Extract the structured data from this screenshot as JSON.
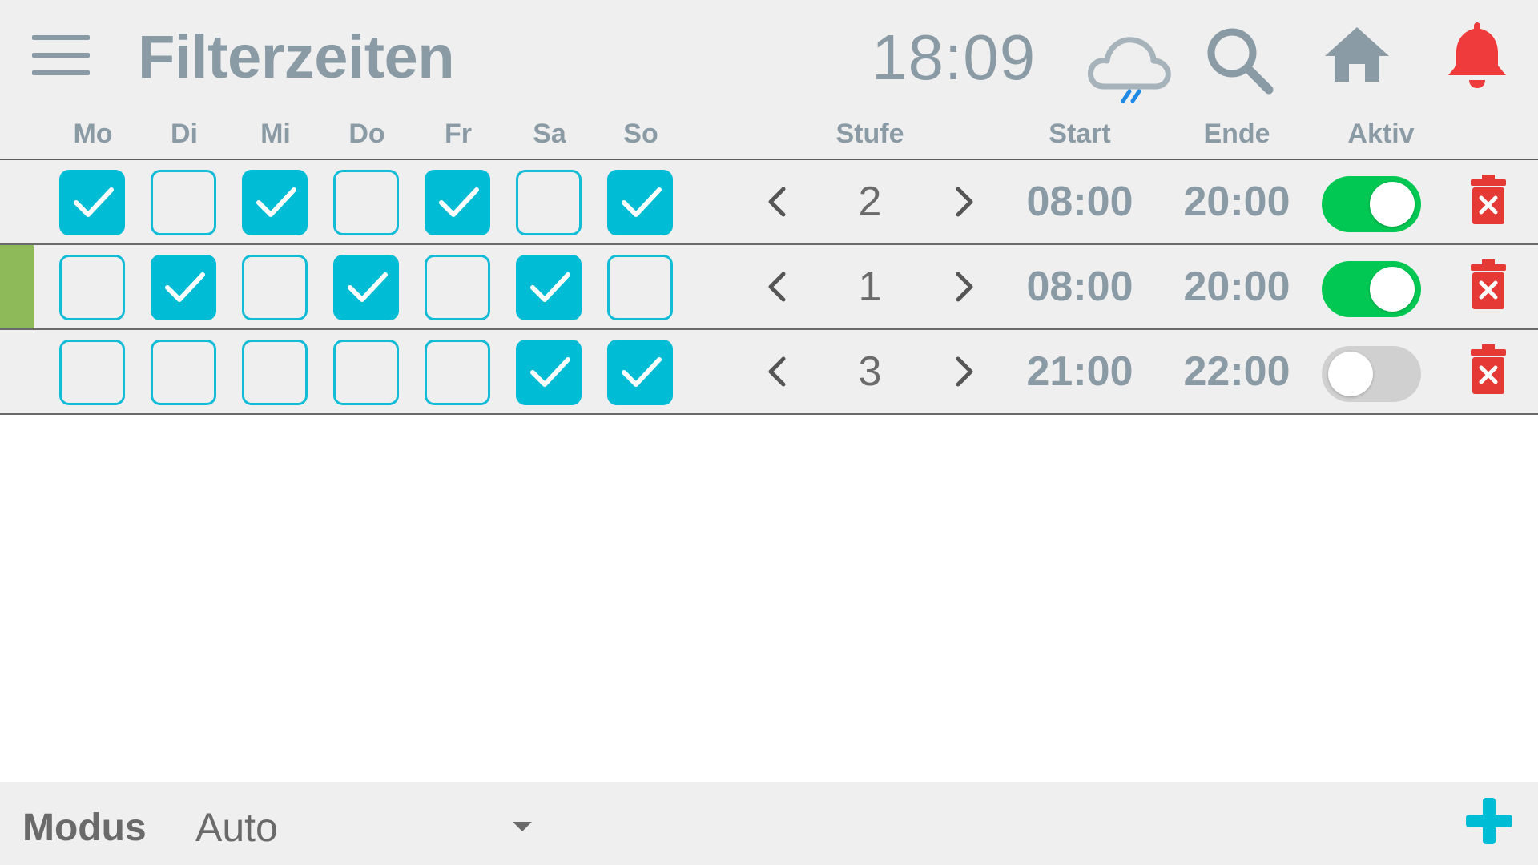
{
  "header": {
    "title": "Filterzeiten",
    "time": "18:09",
    "icons": [
      "menu-icon",
      "rain-cloud-icon",
      "search-icon",
      "home-icon",
      "bell-icon"
    ],
    "colors": {
      "title": "#8b9ba5",
      "bell": "#ef3b3b",
      "rain": "#1e88e5"
    }
  },
  "columns": {
    "days": [
      "Mo",
      "Di",
      "Mi",
      "Do",
      "Fr",
      "Sa",
      "So"
    ],
    "stufe": "Stufe",
    "start": "Start",
    "ende": "Ende",
    "aktiv": "Aktiv"
  },
  "rows": [
    {
      "days": [
        true,
        false,
        true,
        false,
        true,
        false,
        true
      ],
      "stufe": "2",
      "start": "08:00",
      "ende": "20:00",
      "aktiv": true,
      "selected": false
    },
    {
      "days": [
        false,
        true,
        false,
        true,
        false,
        true,
        false
      ],
      "stufe": "1",
      "start": "08:00",
      "ende": "20:00",
      "aktiv": true,
      "selected": true
    },
    {
      "days": [
        false,
        false,
        false,
        false,
        false,
        true,
        true
      ],
      "stufe": "3",
      "start": "21:00",
      "ende": "22:00",
      "aktiv": false,
      "selected": false
    }
  ],
  "footer": {
    "modus_label": "Modus",
    "modus_value": "Auto"
  },
  "colors": {
    "checkbox": "#00bcd4",
    "toggle_on": "#00c853",
    "toggle_off": "#d0d0d0",
    "delete": "#e53935",
    "add": "#00bcd4",
    "selected_row": "#8fba5a"
  }
}
